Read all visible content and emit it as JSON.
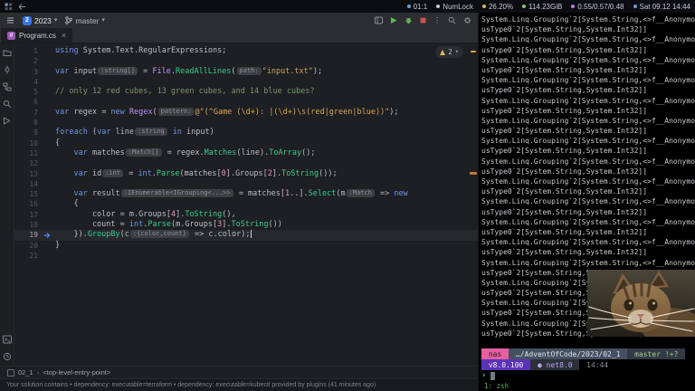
{
  "icons": {
    "chevron_down": "▾",
    "breadcrumb_sep": "›",
    "more_vertical": "⋮",
    "close": "×",
    "csharp_file": "#"
  },
  "system_bar": {
    "right_items": [
      {
        "label": "01:1",
        "color": "#6E9FD6"
      },
      {
        "label": "NumLock",
        "color": "#C9CDD3"
      },
      {
        "label": "26.20%",
        "color": "#D6B56E"
      },
      {
        "label": "114.23GiB",
        "color": "#8FBF71"
      },
      {
        "label": "0.55/0.57/0.48",
        "color": "#BB7FD6"
      },
      {
        "label": "Sat 09.12 14:44",
        "color": "#6E9FD6"
      }
    ]
  },
  "ide": {
    "title_bar": {
      "project": "2023",
      "project_initial": "2",
      "branch": "master"
    },
    "tab": {
      "label": "Program.cs"
    },
    "inspections": {
      "warnings": "2"
    },
    "breadcrumbs": [
      "02_1",
      "<top-level-entry-point>"
    ],
    "status_bar": {
      "message": "Your solution contains • dependency: executable=terraform • dependency: executable=kubectl provided by plugins (41 minutes ago)"
    },
    "editor": {
      "caret_line": 19,
      "lines": [
        {
          "n": 1,
          "tokens": [
            {
              "t": "using ",
              "c": "kw"
            },
            {
              "t": "System.Text.RegularExpressions;",
              "c": "pl"
            }
          ]
        },
        {
          "n": 2,
          "tokens": []
        },
        {
          "n": 3,
          "tokens": [
            {
              "t": "var ",
              "c": "kw"
            },
            {
              "t": "input",
              "c": "pl"
            },
            {
              "t": ":string[]",
              "c": "inlay"
            },
            {
              "t": " = ",
              "c": "pl"
            },
            {
              "t": "File",
              "c": "ty"
            },
            {
              "t": ".",
              "c": "pl"
            },
            {
              "t": "ReadAllLines",
              "c": "me"
            },
            {
              "t": "(",
              "c": "pl"
            },
            {
              "t": "path:",
              "c": "inlay"
            },
            {
              "t": "\"input.txt\"",
              "c": "st"
            },
            {
              "t": ");",
              "c": "pl"
            }
          ]
        },
        {
          "n": 4,
          "tokens": []
        },
        {
          "n": 5,
          "tokens": [
            {
              "t": "// only 12 red cubes, 13 green cubes, and 14 blue cubes?",
              "c": "cm"
            }
          ]
        },
        {
          "n": 6,
          "tokens": []
        },
        {
          "n": 7,
          "tokens": [
            {
              "t": "var ",
              "c": "kw"
            },
            {
              "t": "regex = ",
              "c": "pl"
            },
            {
              "t": "new ",
              "c": "kw"
            },
            {
              "t": "Regex",
              "c": "ty"
            },
            {
              "t": "(",
              "c": "pl"
            },
            {
              "t": "pattern:",
              "c": "inlay"
            },
            {
              "t": "@\"(^Game (\\d+): |(\\d+)\\s(red|green|blue))\"",
              "c": "rx"
            },
            {
              "t": ");",
              "c": "pl"
            }
          ]
        },
        {
          "n": 8,
          "tokens": []
        },
        {
          "n": 9,
          "tokens": [
            {
              "t": "foreach ",
              "c": "kw"
            },
            {
              "t": "(",
              "c": "pl"
            },
            {
              "t": "var ",
              "c": "kw"
            },
            {
              "t": "line",
              "c": "pl"
            },
            {
              "t": ":string",
              "c": "inlay"
            },
            {
              "t": " ",
              "c": "pl"
            },
            {
              "t": "in",
              "c": "kw"
            },
            {
              "t": " input)",
              "c": "pl"
            }
          ]
        },
        {
          "n": 10,
          "tokens": [
            {
              "t": "{",
              "c": "pl"
            }
          ]
        },
        {
          "n": 11,
          "tokens": [
            {
              "t": "    ",
              "c": "pl"
            },
            {
              "t": "var ",
              "c": "kw"
            },
            {
              "t": "matches",
              "c": "pl"
            },
            {
              "t": ":Match[]",
              "c": "inlay"
            },
            {
              "t": " = regex.",
              "c": "pl"
            },
            {
              "t": "Matches",
              "c": "me"
            },
            {
              "t": "(line).",
              "c": "pl"
            },
            {
              "t": "ToArray",
              "c": "me"
            },
            {
              "t": "();",
              "c": "pl"
            }
          ]
        },
        {
          "n": 12,
          "tokens": []
        },
        {
          "n": 13,
          "tokens": [
            {
              "t": "    ",
              "c": "pl"
            },
            {
              "t": "var ",
              "c": "kw"
            },
            {
              "t": "id",
              "c": "pl"
            },
            {
              "t": ":int",
              "c": "inlay"
            },
            {
              "t": " = ",
              "c": "pl"
            },
            {
              "t": "int",
              "c": "kw"
            },
            {
              "t": ".",
              "c": "pl"
            },
            {
              "t": "Parse",
              "c": "me"
            },
            {
              "t": "(matches[",
              "c": "pl"
            },
            {
              "t": "0",
              "c": "nu"
            },
            {
              "t": "].Groups[",
              "c": "pl"
            },
            {
              "t": "2",
              "c": "nu"
            },
            {
              "t": "].",
              "c": "pl"
            },
            {
              "t": "ToString",
              "c": "me"
            },
            {
              "t": "());",
              "c": "pl"
            }
          ]
        },
        {
          "n": 14,
          "tokens": []
        },
        {
          "n": 15,
          "tokens": [
            {
              "t": "    ",
              "c": "pl"
            },
            {
              "t": "var ",
              "c": "kw"
            },
            {
              "t": "result",
              "c": "pl"
            },
            {
              "t": ":IEnumerable<IGrouping<...>>",
              "c": "inlay"
            },
            {
              "t": " = matches[",
              "c": "pl"
            },
            {
              "t": "1",
              "c": "nu"
            },
            {
              "t": "..].",
              "c": "pl"
            },
            {
              "t": "Select",
              "c": "me"
            },
            {
              "t": "(m",
              "c": "pl"
            },
            {
              "t": ":Match",
              "c": "inlay"
            },
            {
              "t": " => ",
              "c": "pl"
            },
            {
              "t": "new",
              "c": "kw"
            }
          ]
        },
        {
          "n": 16,
          "tokens": [
            {
              "t": "    {",
              "c": "pl"
            }
          ]
        },
        {
          "n": 17,
          "tokens": [
            {
              "t": "        color = m.Groups[",
              "c": "pl"
            },
            {
              "t": "4",
              "c": "nu"
            },
            {
              "t": "].",
              "c": "pl"
            },
            {
              "t": "ToString",
              "c": "me"
            },
            {
              "t": "(),",
              "c": "pl"
            }
          ]
        },
        {
          "n": 18,
          "tokens": [
            {
              "t": "        count = ",
              "c": "pl"
            },
            {
              "t": "int",
              "c": "kw"
            },
            {
              "t": ".",
              "c": "pl"
            },
            {
              "t": "Parse",
              "c": "me"
            },
            {
              "t": "(m.Groups[",
              "c": "pl"
            },
            {
              "t": "3",
              "c": "nu"
            },
            {
              "t": "].",
              "c": "pl"
            },
            {
              "t": "ToString",
              "c": "me"
            },
            {
              "t": "())",
              "c": "pl"
            }
          ]
        },
        {
          "n": 19,
          "tokens": [
            {
              "t": "    }).",
              "c": "pl"
            },
            {
              "t": "GroupBy",
              "c": "me"
            },
            {
              "t": "(c",
              "c": "pl"
            },
            {
              "t": ":{color,count}",
              "c": "inlay"
            },
            {
              "t": " => c.color);",
              "c": "pl"
            }
          ]
        },
        {
          "n": 20,
          "tokens": [
            {
              "t": "}",
              "c": "pl"
            }
          ]
        },
        {
          "n": 21,
          "tokens": []
        }
      ]
    }
  },
  "terminal": {
    "output_lines": [
      "System.Linq.Grouping`2[System.String,<>f__Anonymo",
      "usType0`2[System.String,System.Int32]]",
      "System.Linq.Grouping`2[System.String,<>f__Anonymo",
      "usType0`2[System.String,System.Int32]]",
      "System.Linq.Grouping`2[System.String,<>f__Anonymo",
      "usType0`2[System.String,System.Int32]]",
      "System.Linq.Grouping`2[System.String,<>f__Anonymo",
      "usType0`2[System.String,System.Int32]]",
      "System.Linq.Grouping`2[System.String,<>f__Anonymo",
      "usType0`2[System.String,System.Int32]]",
      "System.Linq.Grouping`2[System.String,<>f__Anonymo",
      "usType0`2[System.String,System.Int32]]",
      "System.Linq.Grouping`2[System.String,<>f__Anonymo",
      "usType0`2[System.String,System.Int32]]",
      "System.Linq.Grouping`2[System.String,<>f__Anonymo",
      "usType0`2[System.String,System.Int32]]",
      "System.Linq.Grouping`2[System.String,<>f__Anonymo",
      "usType0`2[System.String,System.Int32]]",
      "System.Linq.Grouping`2[System.String,<>f__Anonymo",
      "usType0`2[System.String,System.Int32]]",
      "System.Linq.Grouping`2[System.String,<>f__Anonymo",
      "usType0`2[System.String,System.Int32]]",
      "System.Linq.Grouping`2[System.String,<>f__Anonymo",
      "usType0`2[System.String,System.Int32]]",
      "System.Linq.Grouping`2[System.String,<>f__Anonymo",
      "usType0`2[System.String,System.Int32]]",
      "System.Linq.Grouping`2[System.String,<>f__Anonymo",
      "usType0`2[System.String,System.Int32]]",
      "System.Linq.Grouping`2[System.String,<>f__Anonymo",
      "usType0`2[System.String,System.Int32]]",
      "System.Linq.Grouping`2[System.String,<>f__Anonymo",
      "usType0`2[System.String,System.Int32]]"
    ],
    "prompt": {
      "line1": [
        {
          "text": " nas ",
          "bg": "#E75EA1",
          "fg": "#1D1D1D"
        },
        {
          "text": " …/AdventOfCode/2023/02_1 ",
          "bg": "#445060",
          "fg": "#DDE3EA"
        },
        {
          "text": " master !+? ",
          "bg": "#323A46",
          "fg": "#A7CE89"
        }
      ],
      "line2": [
        {
          "text": " v8.0.100 ",
          "bg": "#5A33B4",
          "fg": "#F2EFFA"
        },
        {
          "text": " ● net8.0 ",
          "bg": "#2C3038",
          "fg": "#B9A3E3"
        },
        {
          "text": " 14:44 ",
          "bg": "",
          "fg": "#8A8F98"
        }
      ],
      "char": "›"
    },
    "tmux": "1: zsh"
  }
}
